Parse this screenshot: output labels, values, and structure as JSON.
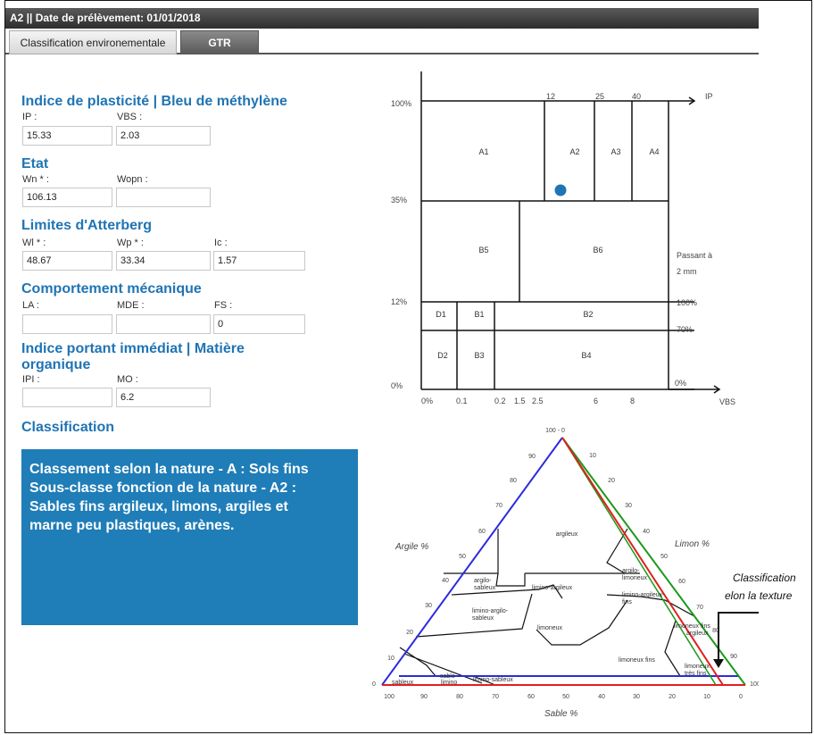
{
  "window": {
    "title": "A2 || Date de prélèvement: 01/01/2018"
  },
  "tabs": [
    {
      "label": "Classification environementale",
      "active": false
    },
    {
      "label": "GTR",
      "active": true
    }
  ],
  "sections": {
    "plasticite": {
      "title": "Indice de plasticité | Bleu de méthylène",
      "fields": [
        {
          "label": "IP :",
          "value": "15.33"
        },
        {
          "label": "VBS :",
          "value": "2.03"
        }
      ]
    },
    "etat": {
      "title": "Etat",
      "fields": [
        {
          "label": "Wn * :",
          "value": "106.13"
        },
        {
          "label": "Wopn :",
          "value": ""
        }
      ]
    },
    "atterberg": {
      "title": "Limites d'Atterberg",
      "fields": [
        {
          "label": "Wl * :",
          "value": "48.67"
        },
        {
          "label": "Wp * :",
          "value": "33.34"
        },
        {
          "label": "Ic :",
          "value": "1.57"
        }
      ]
    },
    "mecanique": {
      "title": "Comportement mécanique",
      "fields": [
        {
          "label": "LA :",
          "value": ""
        },
        {
          "label": "MDE :",
          "value": ""
        },
        {
          "label": "FS :",
          "value": "0"
        }
      ]
    },
    "ipi": {
      "title_line1": "Indice portant immédiat | Matière",
      "title_line2": "organique",
      "fields": [
        {
          "label": "IPI :",
          "value": ""
        },
        {
          "label": "MO :",
          "value": "6.2"
        }
      ]
    },
    "classification": {
      "title": "Classification",
      "lines": [
        "Classement selon la nature - A : Sols fins",
        "Sous-classe fonction de la nature - A2 :",
        "Sables fins argileux, limons, argiles et",
        "marne peu plastiques, arènes."
      ]
    }
  },
  "colors": {
    "accent": "#1f74b4",
    "result_bg": "#1f7db8",
    "point": "#1f74b4"
  },
  "gtr_chart": {
    "left_labels": [
      "100%",
      "35%",
      "12%",
      "0%"
    ],
    "top_ticks": [
      "12",
      "25",
      "40"
    ],
    "ip_label": "IP",
    "right_labels": [
      "Passant à",
      "2 mm",
      "100%",
      "70%",
      "0%"
    ],
    "bottom_ticks": [
      "0%",
      "0.1",
      "0.2",
      "1.5",
      "2.5",
      "6",
      "8"
    ],
    "vbs_label": "VBS",
    "classes": [
      "A1",
      "A2",
      "A3",
      "A4",
      "B5",
      "B6",
      "D1",
      "B1",
      "B2",
      "D2",
      "B3",
      "B4"
    ],
    "point_class": "A2"
  },
  "texture_chart": {
    "left_ticks": [
      "100 - 0",
      "90",
      "80",
      "70",
      "60",
      "50",
      "40",
      "30",
      "20",
      "10",
      "0"
    ],
    "right_ticks": [
      "10",
      "20",
      "30",
      "40",
      "50",
      "60",
      "70",
      "80",
      "90",
      "100"
    ],
    "bottom_ticks": [
      "100",
      "90",
      "80",
      "70",
      "60",
      "50",
      "40",
      "30",
      "20",
      "10",
      "0"
    ],
    "argile_label": "Argile %",
    "limon_label": "Limon %",
    "sable_label": "Sable %",
    "zones": [
      "argileux",
      "argilo-",
      "sableux",
      "limino-argileux",
      "argilo-",
      "limoneux",
      "limino-argileux-",
      "fins",
      "limino-argilo-",
      "sableux",
      "limoneux",
      "limoneux fins",
      "argileux",
      "limoneux fins",
      "limoneux",
      "très fins",
      "sableux",
      "sablo-",
      "limino",
      "limino-sableux"
    ]
  },
  "annotation": {
    "line1": "Classification",
    "line2": "selon la texture"
  }
}
